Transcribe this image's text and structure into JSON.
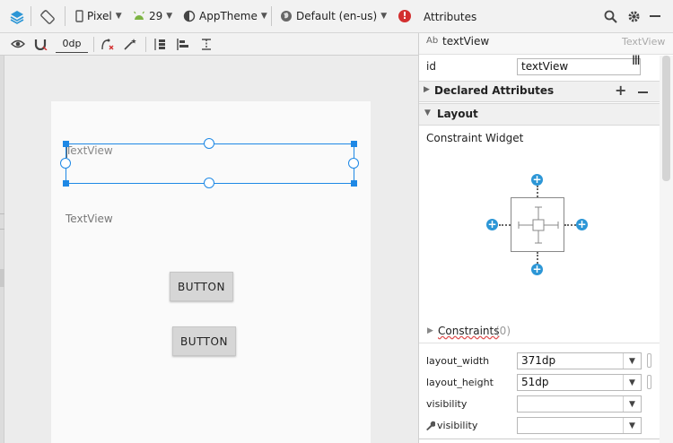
{
  "toolbar": {
    "device": "Pixel",
    "api_level": "29",
    "theme": "AppTheme",
    "locale": "Default (en-us)",
    "default_margin": "0dp"
  },
  "panel": {
    "title": "Attributes",
    "component_type_badge": "Ab",
    "component_name": "textView",
    "component_class": "TextView",
    "id_label": "id",
    "id_value": "textView",
    "declared_attributes": "Declared Attributes",
    "layout_section": "Layout",
    "constraint_widget": "Constraint Widget",
    "constraints_label": "Constraints",
    "constraints_count": "(0)",
    "attributes": [
      {
        "label": "layout_width",
        "value": "371dp"
      },
      {
        "label": "layout_height",
        "value": "51dp"
      },
      {
        "label": "visibility",
        "value": ""
      },
      {
        "label": "visibility",
        "value": ""
      }
    ]
  },
  "canvas": {
    "selected_textview": "TextView",
    "textview2": "TextView",
    "button1": "BUTTON",
    "button2": "BUTTON"
  },
  "colors": {
    "selection": "#1e88e5",
    "add_constraint": "#2c96d6",
    "error": "#d32f2f",
    "android_green": "#7cb342"
  }
}
